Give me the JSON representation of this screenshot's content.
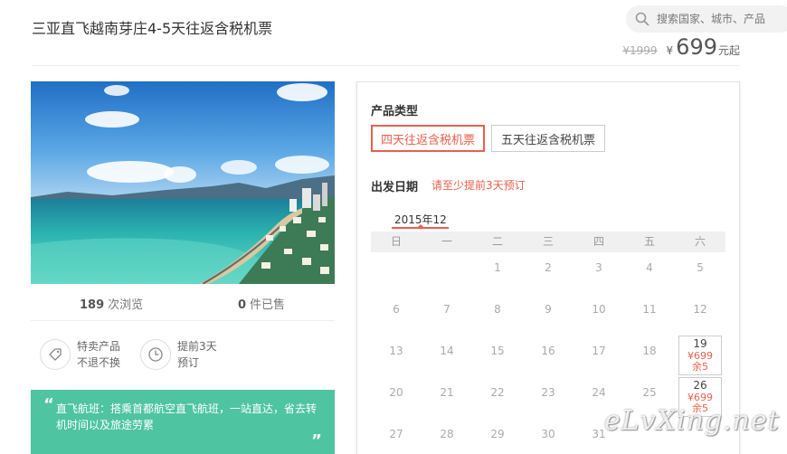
{
  "header": {
    "title": "三亚直飞越南芽庄4-5天往返含税机票",
    "search_placeholder": "搜索国家、城市、产品",
    "search_icon": "search-icon"
  },
  "price": {
    "original": "¥1999",
    "currency": "¥",
    "current": "699",
    "suffix": "元起"
  },
  "stats": {
    "views_count": "189",
    "views_label": "次浏览",
    "sold_count": "0",
    "sold_label": "件已售"
  },
  "features": [
    {
      "icon": "tag-icon",
      "line1": "特卖产品",
      "line2": "不退不换"
    },
    {
      "icon": "clock-icon",
      "line1": "提前3天",
      "line2": "预订"
    }
  ],
  "notice": {
    "open_quote": "“",
    "text": "直飞航班：搭乘首都航空直飞航班，一站直达，省去转机时间以及旅途劳累",
    "close_quote": "”"
  },
  "booking": {
    "product_type_label": "产品类型",
    "options": [
      {
        "label": "四天往返含税机票",
        "selected": true
      },
      {
        "label": "五天往返含税机票",
        "selected": false
      }
    ],
    "date_label": "出发日期",
    "date_hint": "请至少提前3天预订",
    "month": "2015年12",
    "weekdays": [
      "日",
      "一",
      "二",
      "三",
      "四",
      "五",
      "六"
    ],
    "weeks": [
      [
        {
          "d": ""
        },
        {
          "d": ""
        },
        {
          "d": "1"
        },
        {
          "d": "2"
        },
        {
          "d": "3"
        },
        {
          "d": "4"
        },
        {
          "d": "5"
        }
      ],
      [
        {
          "d": "6"
        },
        {
          "d": "7"
        },
        {
          "d": "8"
        },
        {
          "d": "9"
        },
        {
          "d": "10"
        },
        {
          "d": "11"
        },
        {
          "d": "12"
        }
      ],
      [
        {
          "d": "13"
        },
        {
          "d": "14"
        },
        {
          "d": "15"
        },
        {
          "d": "16"
        },
        {
          "d": "17"
        },
        {
          "d": "18"
        },
        {
          "d": "19",
          "price": "¥699",
          "remain": "余5"
        }
      ],
      [
        {
          "d": "20"
        },
        {
          "d": "21"
        },
        {
          "d": "22"
        },
        {
          "d": "23"
        },
        {
          "d": "24"
        },
        {
          "d": "25"
        },
        {
          "d": "26",
          "price": "¥699",
          "remain": "余5"
        }
      ],
      [
        {
          "d": "27"
        },
        {
          "d": "28"
        },
        {
          "d": "29"
        },
        {
          "d": "30"
        },
        {
          "d": "31"
        },
        {
          "d": ""
        },
        {
          "d": ""
        }
      ]
    ]
  },
  "watermark": "eLvXing.net",
  "colors": {
    "accent": "#e8604c",
    "notice_bg": "#4ec4a0"
  }
}
